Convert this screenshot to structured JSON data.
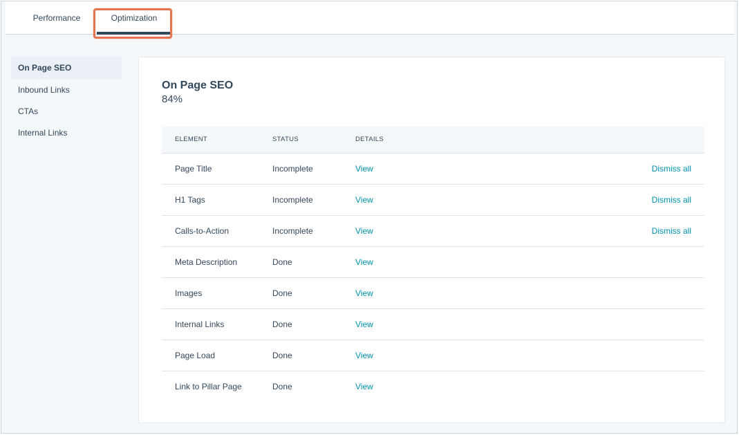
{
  "tabs": [
    {
      "label": "Performance",
      "active": false
    },
    {
      "label": "Optimization",
      "active": true
    }
  ],
  "sidebar": {
    "items": [
      {
        "label": "On Page SEO",
        "active": true
      },
      {
        "label": "Inbound Links",
        "active": false
      },
      {
        "label": "CTAs",
        "active": false
      },
      {
        "label": "Internal Links",
        "active": false
      }
    ]
  },
  "main": {
    "title": "On Page SEO",
    "score": "84%",
    "table": {
      "headers": [
        "ELEMENT",
        "STATUS",
        "DETAILS"
      ],
      "rows": [
        {
          "element": "Page Title",
          "status": "Incomplete",
          "details": "View",
          "action": "Dismiss all"
        },
        {
          "element": "H1 Tags",
          "status": "Incomplete",
          "details": "View",
          "action": "Dismiss all"
        },
        {
          "element": "Calls-to-Action",
          "status": "Incomplete",
          "details": "View",
          "action": "Dismiss all"
        },
        {
          "element": "Meta Description",
          "status": "Done",
          "details": "View",
          "action": ""
        },
        {
          "element": "Images",
          "status": "Done",
          "details": "View",
          "action": ""
        },
        {
          "element": "Internal Links",
          "status": "Done",
          "details": "View",
          "action": ""
        },
        {
          "element": "Page Load",
          "status": "Done",
          "details": "View",
          "action": ""
        },
        {
          "element": "Link to Pillar Page",
          "status": "Done",
          "details": "View",
          "action": ""
        }
      ]
    }
  },
  "colors": {
    "text": "#33475b",
    "link": "#0091ae",
    "highlight": "#e8744f",
    "background": "#f5f8fa"
  }
}
